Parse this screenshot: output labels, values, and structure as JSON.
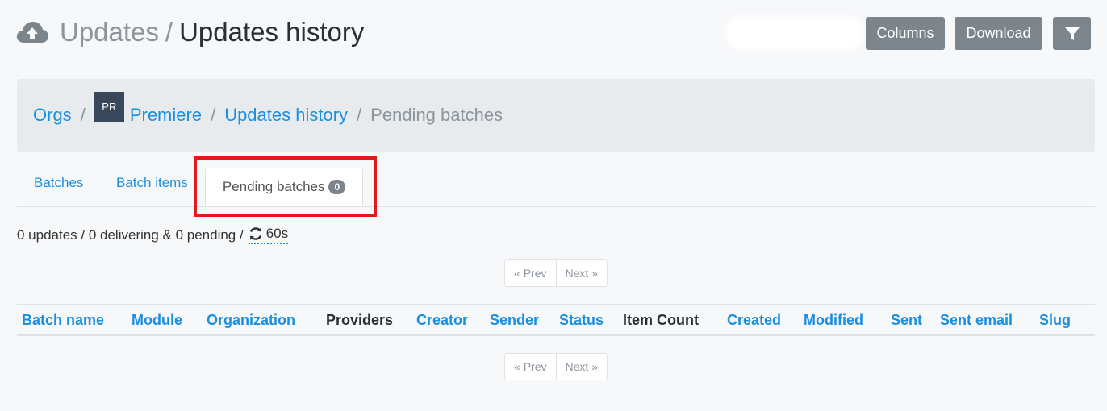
{
  "header": {
    "icon": "cloud-upload-icon",
    "section": "Updates",
    "separator": "/",
    "title": "Updates history"
  },
  "toolbar": {
    "columns_label": "Columns",
    "download_label": "Download",
    "filter_icon": "filter-icon"
  },
  "breadcrumb": {
    "orgs": "Orgs",
    "avatar_initials": "PR",
    "org_name": "Premiere",
    "updates_history": "Updates history",
    "current": "Pending batches",
    "separator": "/"
  },
  "tabs": [
    {
      "label": "Batches"
    },
    {
      "label": "Batch items"
    },
    {
      "label": "Pending batches",
      "badge": "0",
      "active": true
    }
  ],
  "summary": {
    "text": "0 updates / 0 delivering & 0 pending /",
    "refresh_interval": "60s"
  },
  "pagination": {
    "prev": "« Prev",
    "next": "Next »"
  },
  "table": {
    "columns": [
      {
        "label": "Batch name",
        "sortable": true
      },
      {
        "label": "Module",
        "sortable": true
      },
      {
        "label": "Organization",
        "sortable": true
      },
      {
        "label": "Providers",
        "sortable": false
      },
      {
        "label": "Creator",
        "sortable": true
      },
      {
        "label": "Sender",
        "sortable": true
      },
      {
        "label": "Status",
        "sortable": true
      },
      {
        "label": "Item Count",
        "sortable": false
      },
      {
        "label": "Created",
        "sortable": true
      },
      {
        "label": "Modified",
        "sortable": true
      },
      {
        "label": "Sent",
        "sortable": true
      },
      {
        "label": "Sent email",
        "sortable": true
      },
      {
        "label": "Slug",
        "sortable": true
      }
    ]
  },
  "colors": {
    "link": "#1a8fe0",
    "button": "#7d858c",
    "highlight": "#e2191e",
    "avatar": "#38475a"
  }
}
